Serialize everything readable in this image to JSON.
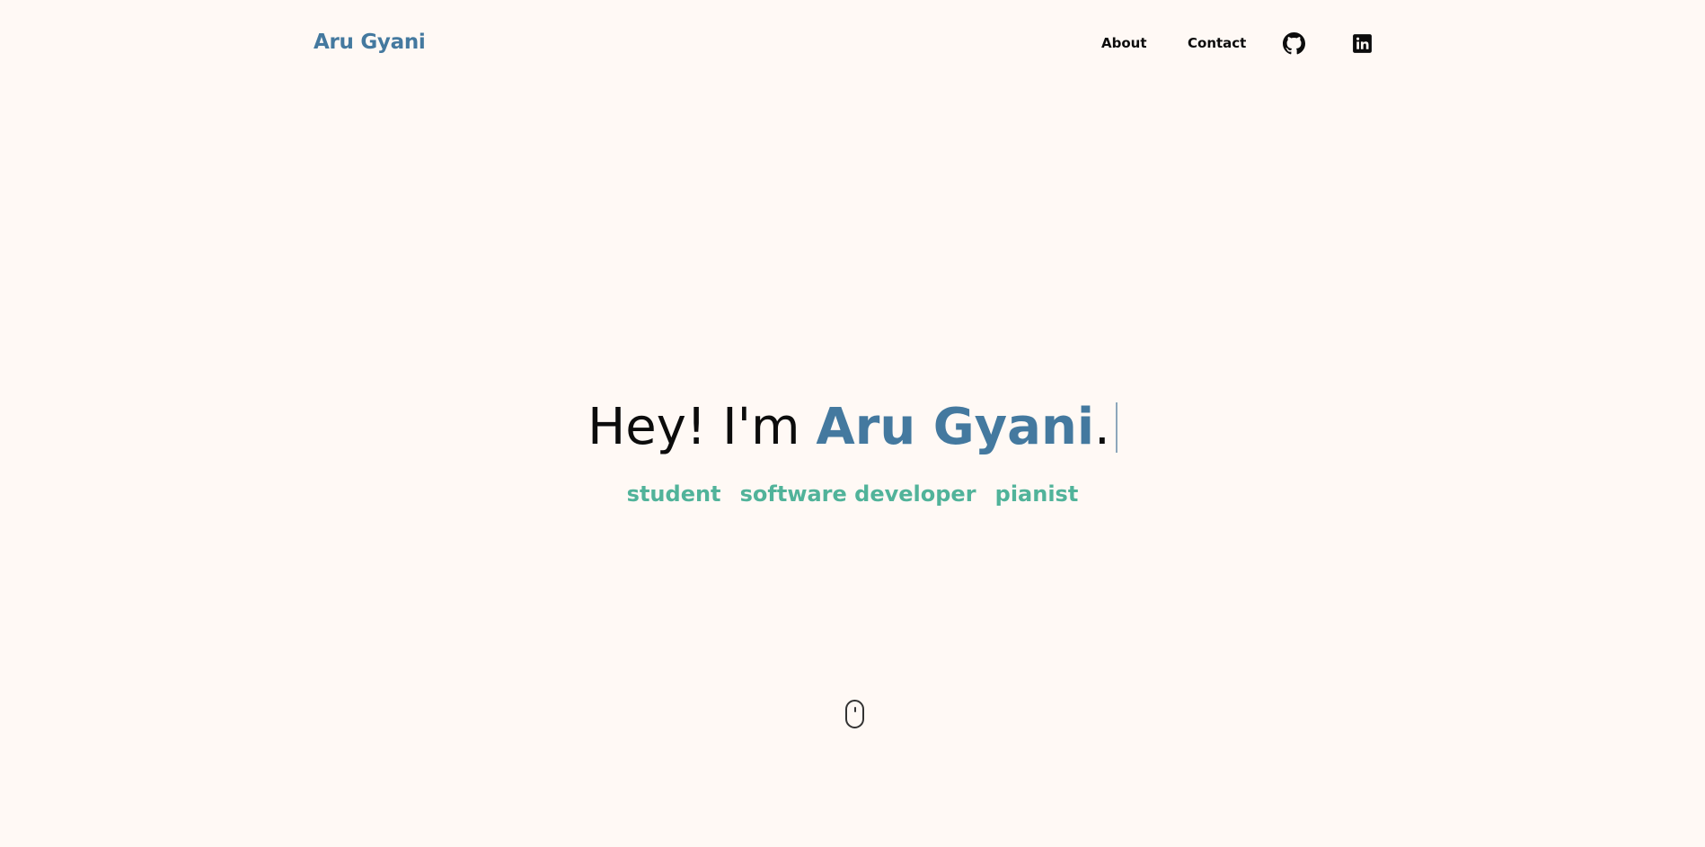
{
  "nav": {
    "brand": "Aru Gyani",
    "links": [
      {
        "label": "About"
      },
      {
        "label": "Contact"
      }
    ],
    "icons": [
      "github-icon",
      "linkedin-icon"
    ]
  },
  "hero": {
    "greeting": "Hey! I'm ",
    "name": "Aru Gyani",
    "period": ".",
    "roles": [
      "student",
      "software developer",
      "pianist"
    ]
  },
  "colors": {
    "background": "#fff9f5",
    "brand": "#44799f",
    "accent": "#51b39a",
    "text": "#0c0c0c"
  },
  "scroll_indicator": "mouse-scroll-icon"
}
